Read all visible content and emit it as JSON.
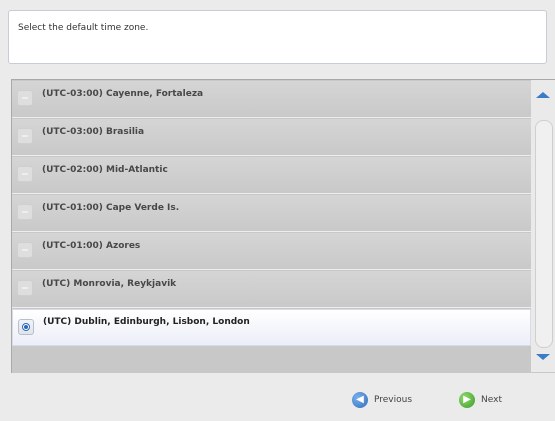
{
  "instruction": "Select the default time zone.",
  "timezones": [
    {
      "label": "(UTC-03:00) Cayenne, Fortaleza",
      "selected": false
    },
    {
      "label": "(UTC-03:00) Brasilia",
      "selected": false
    },
    {
      "label": "(UTC-02:00) Mid-Atlantic",
      "selected": false
    },
    {
      "label": "(UTC-01:00) Cape Verde Is.",
      "selected": false
    },
    {
      "label": "(UTC-01:00) Azores",
      "selected": false
    },
    {
      "label": "(UTC) Monrovia, Reykjavik",
      "selected": false
    },
    {
      "label": "(UTC) Dublin, Edinburgh, Lisbon, London",
      "selected": true
    }
  ],
  "footer": {
    "previous_label": "Previous",
    "next_label": "Next",
    "previous_icon": "arrow-left-icon",
    "next_icon": "arrow-right-icon"
  },
  "colors": {
    "accent": "#3b7bc8",
    "next_green": "#3b9a28",
    "selected_row": "#f4f5fb"
  }
}
